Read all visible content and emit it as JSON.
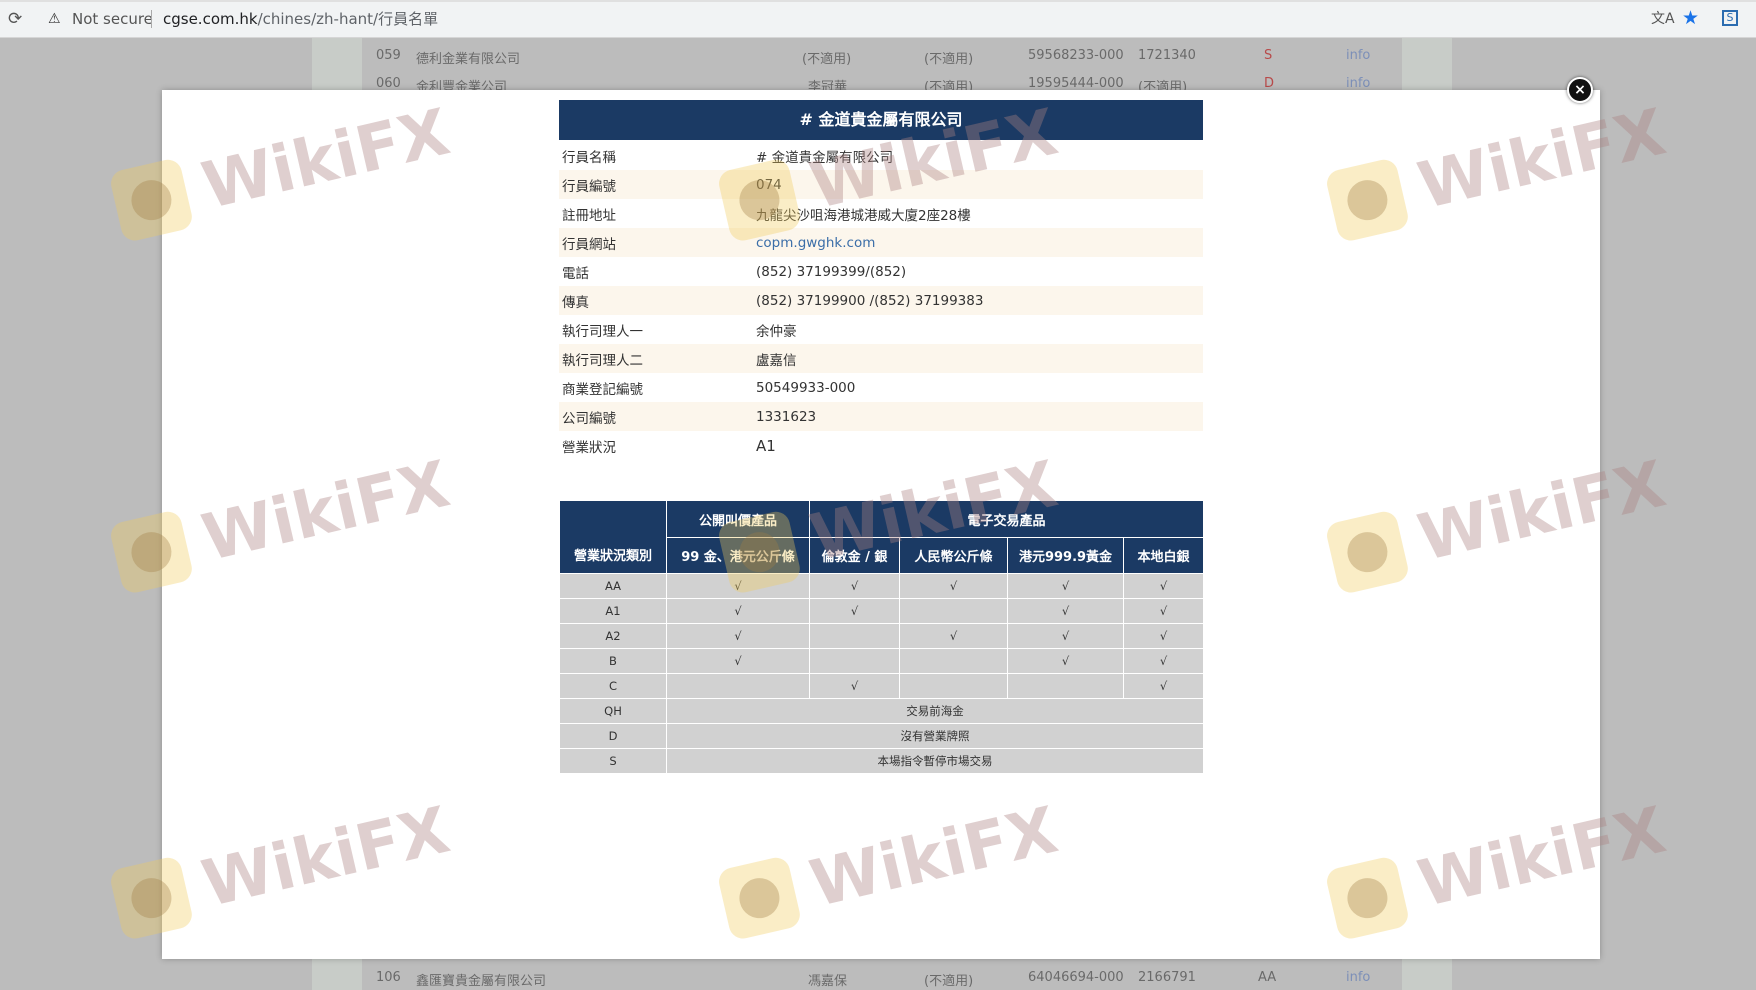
{
  "browser": {
    "reload_icon": "reload-icon",
    "security_label": "Not secure",
    "url_host": "cgse.com.hk",
    "url_path": "/chines/zh-hant/行員名單"
  },
  "background_rows": [
    {
      "no": "059",
      "name": "德利金業有限公司",
      "col1": "(不適用)",
      "col2": "(不適用)",
      "brn": "59568233-000",
      "cr": "1721340",
      "status": "S",
      "info": "info"
    },
    {
      "no": "060",
      "name": "金利豐金業公司",
      "col1": "李冠華",
      "col2": "(不適用)",
      "brn": "19595444-000",
      "cr": "(不適用)",
      "status": "D",
      "info": "info"
    },
    {
      "no": "106",
      "name": "鑫匯寶貴金屬有限公司",
      "col1": "馮嘉保",
      "col2": "(不適用)",
      "brn": "64046694-000",
      "cr": "2166791",
      "status": "AA",
      "info": "info"
    }
  ],
  "modal": {
    "close_symbol": "×",
    "company_title": "# 金道貴金屬有限公司",
    "info_rows": [
      {
        "label": "行員名稱",
        "value": "# 金道貴金屬有限公司"
      },
      {
        "label": "行員編號",
        "value": "074"
      },
      {
        "label": "註冊地址",
        "value": "九龍尖沙咀海港城港威大廈2座28樓"
      },
      {
        "label": "行員網站",
        "value": "copm.gwghk.com"
      },
      {
        "label": "電話",
        "value": "(852) 37199399/(852)"
      },
      {
        "label": "傳真",
        "value": "(852) 37199900 /(852) 37199383"
      },
      {
        "label": "執行司理人一",
        "value": "余仲豪"
      },
      {
        "label": "執行司理人二",
        "value": "盧嘉信"
      },
      {
        "label": "商業登記編號",
        "value": "50549933-000"
      },
      {
        "label": "公司編號",
        "value": "1331623"
      },
      {
        "label": "營業狀況",
        "value": "A1"
      }
    ],
    "status_table": {
      "corner_header": "營業狀況類別",
      "group_open": "公開叫價產品",
      "group_electronic": "電子交易產品",
      "columns": [
        "99 金、港元公斤條",
        "倫敦金 / 銀",
        "人民幣公斤條",
        "港元999.9黃金",
        "本地白銀"
      ],
      "rows": [
        {
          "category": "AA",
          "cells": [
            "√",
            "√",
            "√",
            "√",
            "√"
          ]
        },
        {
          "category": "A1",
          "cells": [
            "√",
            "√",
            "",
            "√",
            "√"
          ]
        },
        {
          "category": "A2",
          "cells": [
            "√",
            "",
            "√",
            "√",
            "√"
          ]
        },
        {
          "category": "B",
          "cells": [
            "√",
            "",
            "",
            "√",
            "√"
          ]
        },
        {
          "category": "C",
          "cells": [
            "",
            "√",
            "",
            "",
            "√"
          ]
        }
      ],
      "span_rows": [
        {
          "category": "QH",
          "text": "交易前海金"
        },
        {
          "category": "D",
          "text": "沒有營業牌照"
        },
        {
          "category": "S",
          "text": "本場指令暫停市場交易"
        }
      ]
    }
  },
  "watermark_text": "WikiFX"
}
